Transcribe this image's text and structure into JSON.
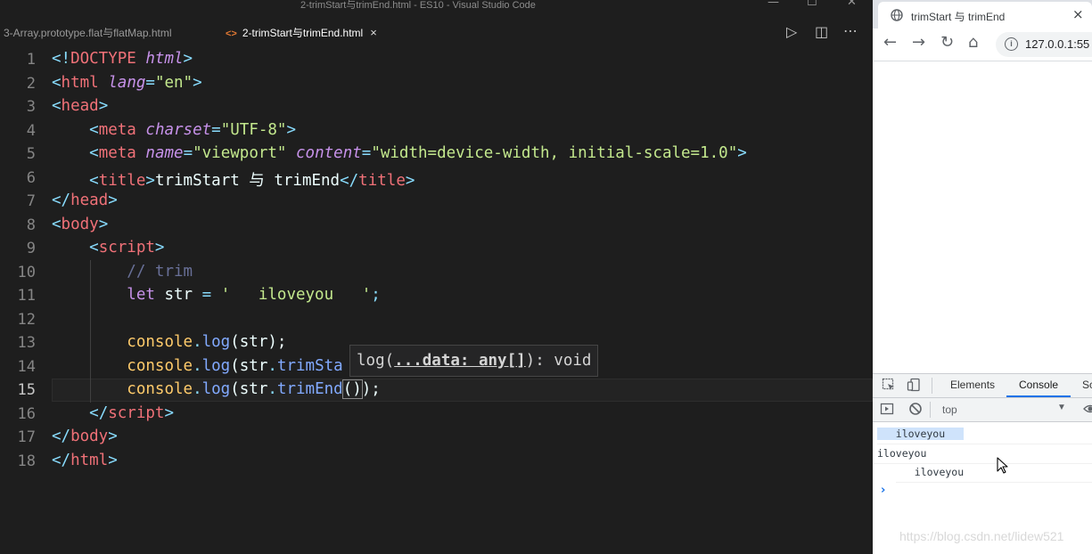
{
  "vscode": {
    "window_title": "2-trimStart与trimEnd.html - ES10 - Visual Studio Code",
    "tabs": [
      {
        "label": "3-Array.prototype.flat与flatMap.html"
      },
      {
        "label": "2-trimStart与trimEnd.html",
        "icon": "<>",
        "close": "×"
      }
    ],
    "line_numbers": [
      "1",
      "2",
      "3",
      "4",
      "5",
      "6",
      "7",
      "8",
      "9",
      "10",
      "11",
      "12",
      "13",
      "14",
      "15",
      "16",
      "17",
      "18"
    ],
    "hover_tooltip": {
      "fn": "log(",
      "param": "...data: any[]",
      "ret": "): void"
    },
    "code": {
      "l1": {
        "a": "<!",
        "b": "DOCTYPE",
        "c": "html",
        "d": ">"
      },
      "l2": {
        "a": "<",
        "b": "html",
        "c": "lang",
        "d": "=",
        "e": "\"en\"",
        "f": ">"
      },
      "l3": {
        "a": "<",
        "b": "head",
        "c": ">"
      },
      "l4": {
        "a": "<",
        "b": "meta",
        "c": "charset",
        "d": "=",
        "e": "\"UTF-8\"",
        "f": ">"
      },
      "l5": {
        "a": "<",
        "b": "meta",
        "c": "name",
        "d": "=",
        "e": "\"viewport\"",
        "f": "content",
        "g": "=",
        "h": "\"width=device-width, initial-scale=1.0\"",
        "i": ">"
      },
      "l6": {
        "a": "<",
        "b": "title",
        "c": ">",
        "d": "trimStart 与 trimEnd",
        "e": "</",
        "f": "title",
        "g": ">"
      },
      "l7": {
        "a": "</",
        "b": "head",
        "c": ">"
      },
      "l8": {
        "a": "<",
        "b": "body",
        "c": ">"
      },
      "l9": {
        "a": "<",
        "b": "script",
        "c": ">"
      },
      "l10": {
        "a": "// trim"
      },
      "l11": {
        "a": "let",
        "b": "str",
        "c": "=",
        "d": "'   iloveyou   '",
        "e": ";"
      },
      "l13": {
        "a": "console",
        "b": ".",
        "c": "log",
        "d": "(",
        "e": "str",
        "f": ");"
      },
      "l14": {
        "a": "console",
        "b": ".",
        "c": "log",
        "d": "(",
        "e": "str",
        "f": ".",
        "g": "trimSta"
      },
      "l15": {
        "a": "console",
        "b": ".",
        "c": "log",
        "d": "(",
        "e": "str",
        "f": ".",
        "g": "trimEnd",
        "h": "()",
        "i": ");"
      },
      "l16": {
        "a": "</",
        "b": "script",
        "c": ">"
      },
      "l17": {
        "a": "</",
        "b": "body",
        "c": ">"
      },
      "l18": {
        "a": "</",
        "b": "html",
        "c": ">"
      }
    }
  },
  "browser": {
    "tab_title": "trimStart 与 trimEnd",
    "tab_close": "×",
    "url": "127.0.0.1:55",
    "devtools": {
      "tabs": [
        "Elements",
        "Console",
        "Sc"
      ],
      "active_tab": "Console",
      "context": "top",
      "console_lines": [
        "   iloveyou   ",
        "iloveyou",
        "   iloveyou"
      ],
      "prompt": "›"
    },
    "watermark": "https://blog.csdn.net/lidew521"
  },
  "colors": {
    "editor_bg": "#1e1e1e",
    "tag": "#f07178",
    "punctuation": "#89ddff",
    "attribute": "#c792ea",
    "string": "#c3e88d",
    "function": "#82aaff",
    "object": "#ffcb6b",
    "comment": "#697098",
    "devtools_accent": "#1a73e8"
  }
}
